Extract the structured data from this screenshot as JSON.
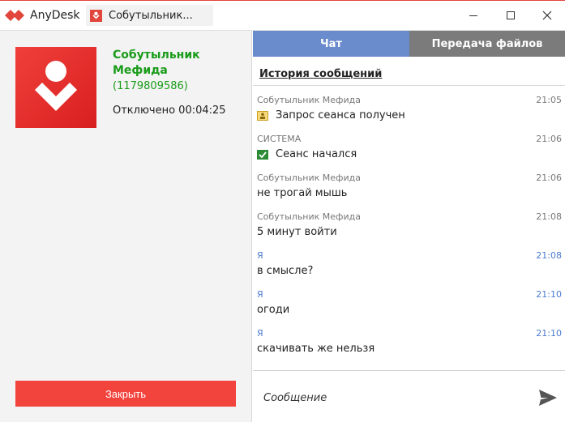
{
  "app": {
    "brand_name": "AnyDesk",
    "tab_title": "Собутыльник..."
  },
  "colors": {
    "accent_red": "#f2433d",
    "online_green": "#1a9c1a",
    "chat_tab_blue": "#6a8ccc",
    "files_tab_gray": "#7b7b7b",
    "me_blue": "#4a7bd0"
  },
  "peer": {
    "name": "Собутыльник Мефида",
    "id": "(1179809586)",
    "status": "Отключено 00:04:25"
  },
  "left_panel": {
    "close_label": "Закрыть"
  },
  "tabs": {
    "chat": "Чат",
    "files": "Передача файлов"
  },
  "chat": {
    "history_title": "История сообщений",
    "messages": [
      {
        "sender": "Собутыльник Мефида",
        "time": "21:05",
        "text": "Запрос сеанса получен",
        "icon": "session-request-icon",
        "from_me": false
      },
      {
        "sender": "СИСТЕМА",
        "time": "21:06",
        "text": "Сеанс начался",
        "icon": "session-started-icon",
        "from_me": false
      },
      {
        "sender": "Собутыльник Мефида",
        "time": "21:06",
        "text": "не трогай мышь",
        "icon": "",
        "from_me": false
      },
      {
        "sender": "Собутыльник Мефида",
        "time": "21:08",
        "text": "5 минут войти",
        "icon": "",
        "from_me": false
      },
      {
        "sender": "Я",
        "time": "21:08",
        "text": "в смысле?",
        "icon": "",
        "from_me": true
      },
      {
        "sender": "Я",
        "time": "21:10",
        "text": "огоди",
        "icon": "",
        "from_me": true
      },
      {
        "sender": "Я",
        "time": "21:10",
        "text": "скачивать же нельзя",
        "icon": "",
        "from_me": true
      }
    ],
    "input_placeholder": "Сообщение"
  }
}
